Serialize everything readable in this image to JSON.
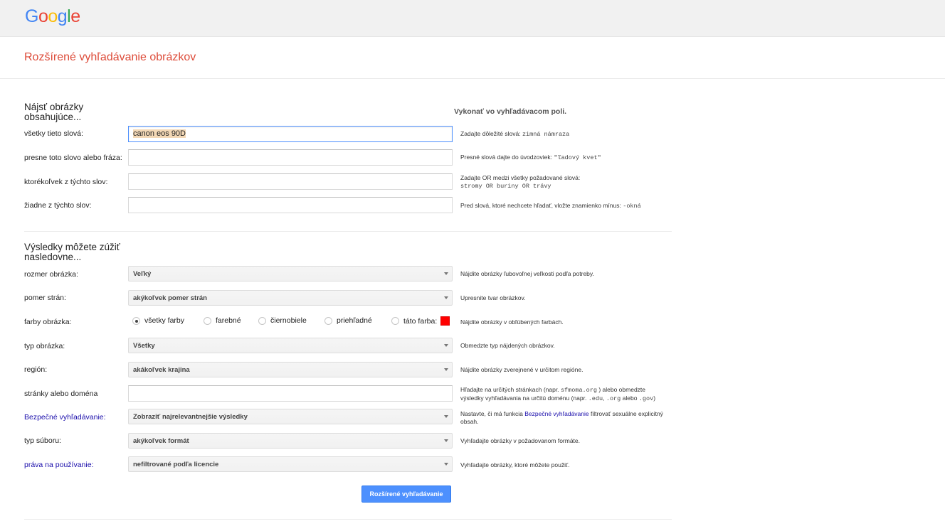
{
  "header": {
    "logo": [
      {
        "ch": "G",
        "color": "#4285f4"
      },
      {
        "ch": "o",
        "color": "#ea4335"
      },
      {
        "ch": "o",
        "color": "#fbbc05"
      },
      {
        "ch": "g",
        "color": "#4285f4"
      },
      {
        "ch": "l",
        "color": "#34a853"
      },
      {
        "ch": "e",
        "color": "#ea4335"
      }
    ]
  },
  "page_title": "Rozšírené vyhľadávanie obrázkov",
  "section1": {
    "heading": "Nájsť obrázky obsahujúce...",
    "side_heading": "Vykonať vo vyhľadávacom poli.",
    "rows": [
      {
        "label": "všetky tieto slová:",
        "value": "canon eos 90D",
        "help": "Zadajte dôležité slová:",
        "help_code": "zimná námraza"
      },
      {
        "label": "presne toto slovo alebo fráza:",
        "value": "",
        "help": "Presné slová dajte do úvodzoviek:",
        "help_code": "\"ľadový kvet\""
      },
      {
        "label": "ktorékoľvek z týchto slov:",
        "value": "",
        "help": "Zadajte OR medzi všetky požadované slová:",
        "help_code": "stromy OR buriny OR trávy"
      },
      {
        "label": "žiadne z týchto slov:",
        "value": "",
        "help": "Pred slová, ktoré nechcete hľadať, vložte znamienko mínus:",
        "help_code": "-okná"
      }
    ]
  },
  "section2": {
    "heading": "Výsledky môžete zúžiť nasledovne...",
    "size": {
      "label": "rozmer obrázka:",
      "value": "Veľký",
      "help": "Nájdite obrázky ľubovoľnej veľkosti podľa potreby."
    },
    "aspect": {
      "label": "pomer strán:",
      "value": "akýkoľvek pomer strán",
      "help": "Upresnite tvar obrázkov."
    },
    "colors": {
      "label": "farby obrázka:",
      "options": [
        "všetky farby",
        "farebné",
        "čiernobiele",
        "priehľadné",
        "táto farba:"
      ],
      "selected": "všetky farby",
      "swatch_color": "#ff0000",
      "help": "Nájdite obrázky v obľúbených farbách."
    },
    "type": {
      "label": "typ obrázka:",
      "value": "Všetky",
      "help": "Obmedzte typ nájdených obrázkov."
    },
    "region": {
      "label": "región:",
      "value": "akákoľvek krajina",
      "help": "Nájdite obrázky zverejnené v určitom regióne."
    },
    "site": {
      "label": "stránky alebo doména",
      "value": "",
      "help1": "Hľadajte na určitých stránkach (napr.",
      "help1_code": "sfmoma.org",
      "help1_end": ") alebo obmedzte",
      "help2": "výsledky vyhľadávania na určitú doménu (napr.",
      "help2_code1": ".edu",
      "help2_mid": ",",
      "help2_code2": ".org",
      "help2_or": "alebo",
      "help2_code3": ".gov",
      "help2_end": ")"
    },
    "safe": {
      "label": "Bezpečné vyhľadávanie:",
      "value": "Zobraziť najrelevantnejšie výsledky",
      "help_pre": "Nastavte, či má funkcia",
      "help_link": "Bezpečné vyhľadávanie",
      "help_post": "filtrovať sexuálne explicitný obsah."
    },
    "filetype": {
      "label": "typ súboru:",
      "value": "akýkoľvek formát",
      "help": "Vyhľadajte obrázky v požadovanom formáte."
    },
    "rights": {
      "label": "práva na používanie:",
      "value": "nefiltrované podľa licencie",
      "help": "Vyhľadajte obrázky, ktoré môžete použiť."
    }
  },
  "submit_label": "Rozšírené vyhľadávanie"
}
